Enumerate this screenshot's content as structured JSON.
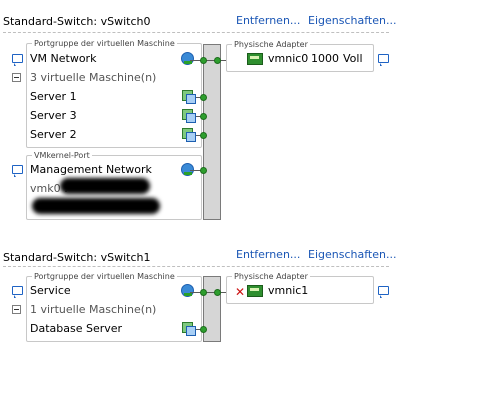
{
  "switches": [
    {
      "title": "Standard-Switch: vSwitch0",
      "remove_label": "Entfernen...",
      "properties_label": "Eigenschaften...",
      "portgroup_legend": "Portgruppe der virtuellen Maschine",
      "portgroup_name": "VM Network",
      "vm_count_label": "3 virtuelle Maschine(n)",
      "vms": [
        "Server 1",
        "Server 3",
        "Server 2"
      ],
      "vmkernel_legend": "VMkernel-Port",
      "vmkernel_name": "Management Network",
      "vmk_label": "vmk0 :",
      "adapter_legend": "Physische Adapter",
      "adapter_name": "vmnic0",
      "adapter_speed": "1000",
      "adapter_duplex": "Voll"
    },
    {
      "title": "Standard-Switch: vSwitch1",
      "remove_label": "Entfernen...",
      "properties_label": "Eigenschaften...",
      "portgroup_legend": "Portgruppe der virtuellen Maschine",
      "portgroup_name": "Service",
      "vm_count_label": "1 virtuelle Maschine(n)",
      "vms": [
        "Database Server"
      ],
      "adapter_legend": "Physische Adapter",
      "adapter_name": "vmnic1"
    }
  ]
}
